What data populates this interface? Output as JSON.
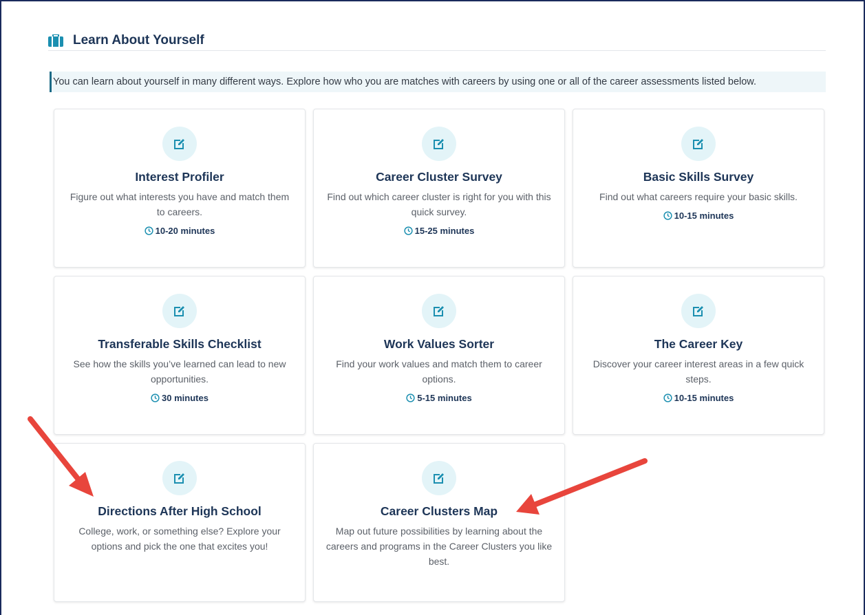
{
  "section": {
    "title": "Learn About Yourself",
    "intro": "You can learn about yourself in many different ways. Explore how who you are matches with careers by using one or all of the career assessments listed below."
  },
  "icons": {
    "section": "briefcase-icon",
    "card": "edit-icon",
    "time": "clock-icon"
  },
  "colors": {
    "accent": "#1b8fb0",
    "title": "#1d3557",
    "icon_bg": "#e3f4f8",
    "arrow": "#e8453c"
  },
  "cards": [
    {
      "title": "Interest Profiler",
      "description": "Figure out what interests you have and match them to careers.",
      "time": "10-20 minutes"
    },
    {
      "title": "Career Cluster Survey",
      "description": "Find out which career cluster is right for you with this quick survey.",
      "time": "15-25 minutes"
    },
    {
      "title": "Basic Skills Survey",
      "description": "Find out what careers require your basic skills.",
      "time": "10-15 minutes"
    },
    {
      "title": "Transferable Skills Checklist",
      "description": "See how the skills you’ve learned can lead to new opportunities.",
      "time": "30 minutes"
    },
    {
      "title": "Work Values Sorter",
      "description": "Find your work values and match them to career options.",
      "time": "5-15 minutes"
    },
    {
      "title": "The Career Key",
      "description": "Discover your career interest areas in a few quick steps.",
      "time": "10-15 minutes"
    },
    {
      "title": "Directions After High School",
      "description": "College, work, or something else? Explore your options and pick the one that excites you!",
      "time": ""
    },
    {
      "title": "Career Clusters Map",
      "description": "Map out future possibilities by learning about the careers and programs in the Career Clusters you like best.",
      "time": ""
    }
  ]
}
